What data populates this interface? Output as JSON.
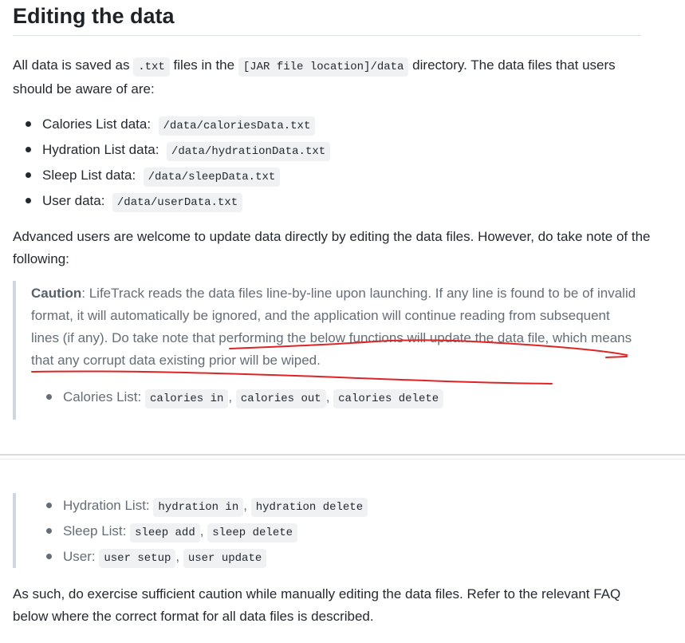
{
  "heading": "Editing the data",
  "intro": {
    "t1": "All data is saved as ",
    "c1": ".txt",
    "t2": " files in the ",
    "c2": "[JAR file location]/data",
    "t3": " directory. The data files that users should be aware of are:"
  },
  "files": [
    {
      "label": "Calories List data:",
      "path": "/data/caloriesData.txt"
    },
    {
      "label": "Hydration List data:",
      "path": "/data/hydrationData.txt"
    },
    {
      "label": "Sleep List data:",
      "path": "/data/sleepData.txt"
    },
    {
      "label": "User data:",
      "path": "/data/userData.txt"
    }
  ],
  "advanced": "Advanced users are welcome to update data directly by editing the data files. However, do take note of the following:",
  "caution": {
    "label": "Caution",
    "text": ": LifeTrack reads the data files line-by-line upon launching. If any line is found to be of invalid format, it will automatically be ignored, and the application will continue reading from subsequent lines (if any). Do take note that performing the below functions will update the data file, which means that any corrupt data existing prior will be wiped."
  },
  "functions_top": [
    {
      "label": "Calories List:",
      "cmds": [
        "calories in",
        "calories out",
        "calories delete"
      ]
    }
  ],
  "functions_bottom": [
    {
      "label": "Hydration List:",
      "cmds": [
        "hydration in",
        "hydration delete"
      ]
    },
    {
      "label": "Sleep List:",
      "cmds": [
        "sleep add",
        "sleep delete"
      ]
    },
    {
      "label": "User:",
      "cmds": [
        "user setup",
        "user update"
      ]
    }
  ],
  "closing": "As such, do exercise sufficient caution while manually editing the data files. Refer to the relevant FAQ below where the correct format for all data files is described.",
  "colors": {
    "annotation": "#e02424",
    "divider": "#d8dadd"
  }
}
